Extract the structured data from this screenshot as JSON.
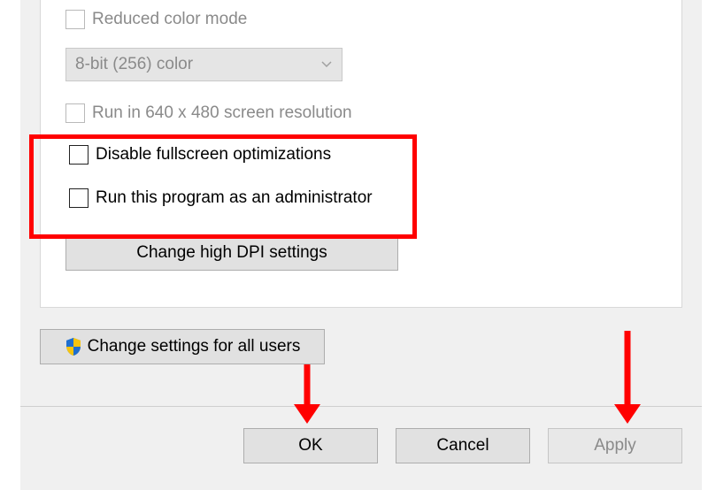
{
  "settings": {
    "reducedColorMode": {
      "label": "Reduced color mode",
      "checked": false
    },
    "colorModeSelect": {
      "value": "8-bit (256) color"
    },
    "run640x480": {
      "label": "Run in 640 x 480 screen resolution",
      "checked": false
    },
    "disableFullscreen": {
      "label": "Disable fullscreen optimizations",
      "checked": false
    },
    "runAsAdmin": {
      "label": "Run this program as an administrator",
      "checked": false
    }
  },
  "buttons": {
    "changeDpi": "Change high DPI settings",
    "changeAllUsers": "Change settings for all users",
    "ok": "OK",
    "cancel": "Cancel",
    "apply": "Apply"
  }
}
